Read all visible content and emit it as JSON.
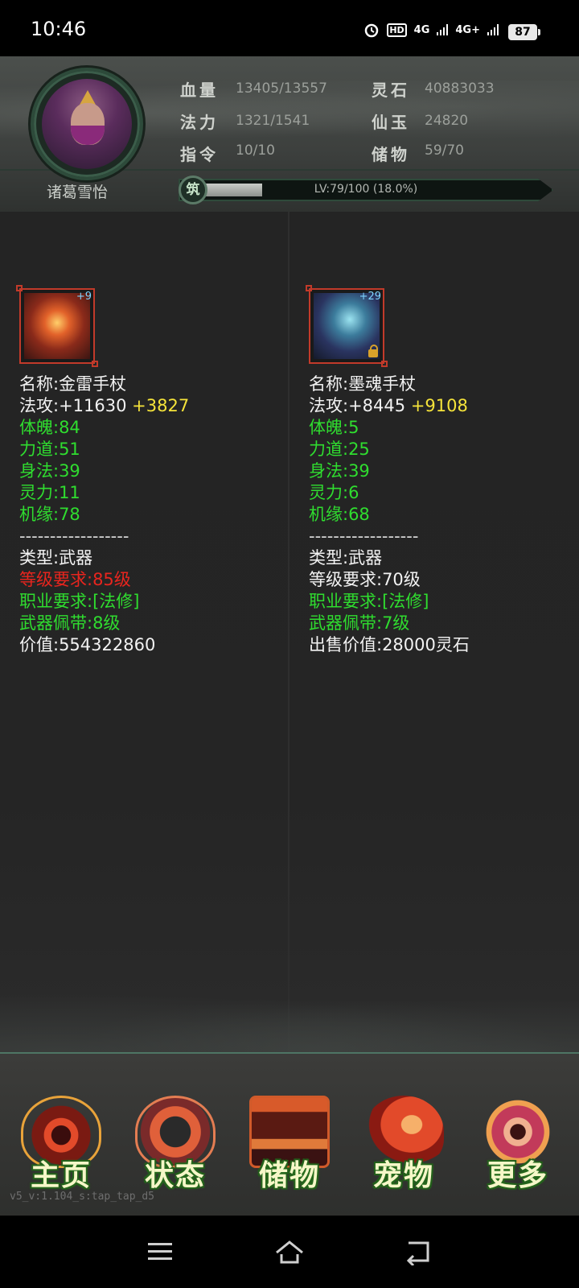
{
  "status_bar": {
    "time": "10:46",
    "network_1": "HD",
    "network_2": "4G",
    "network_3": "4G+",
    "battery": "87"
  },
  "profile": {
    "name": "诸葛雪怡",
    "stats": {
      "hp_label": "血量",
      "hp_value": "13405/13557",
      "mp_label": "法力",
      "mp_value": "1321/1541",
      "cmd_label": "指令",
      "cmd_value": "10/10",
      "stone_label": "灵石",
      "stone_value": "40883033",
      "jade_label": "仙玉",
      "jade_value": "24820",
      "storage_label": "储物",
      "storage_value": "59/70"
    },
    "level_badge": "筑",
    "level_text": "LV:79/100 (18.0%)",
    "level_progress": 0.18
  },
  "items": {
    "left": {
      "plus": "+9",
      "name": "名称:金雷手杖",
      "atk": "法攻:+11630",
      "atk_bonus": "+3827",
      "physique": "体魄:84",
      "strength": "力道:51",
      "agility": "身法:39",
      "spirit": "灵力:11",
      "luck": "机缘:78",
      "divider": "------------------",
      "type": "类型:武器",
      "level_req": "等级要求:85级",
      "class_req": "职业要求:[法修]",
      "weapon_belt": "武器佩带:8级",
      "value": "价值:554322860"
    },
    "right": {
      "plus": "+29",
      "name": "名称:墨魂手杖",
      "atk": "法攻:+8445",
      "atk_bonus": "+9108",
      "physique": "体魄:5",
      "strength": "力道:25",
      "agility": "身法:39",
      "spirit": "灵力:6",
      "luck": "机缘:68",
      "divider": "------------------",
      "type": "类型:武器",
      "level_req": "等级要求:70级",
      "class_req": "职业要求:[法修]",
      "weapon_belt": "武器佩带:7级",
      "value": "出售价值:28000灵石"
    }
  },
  "nav": {
    "home": "主页",
    "status": "状态",
    "storage": "储物",
    "pet": "宠物",
    "more": "更多"
  },
  "version": "v5_v:1.104_s:tap_tap_d5",
  "colors": {
    "green_stat": "#2fdd2f",
    "red_req": "#e8251e",
    "yellow_bonus": "#f5e33a",
    "accent_border": "#c23a2a"
  }
}
